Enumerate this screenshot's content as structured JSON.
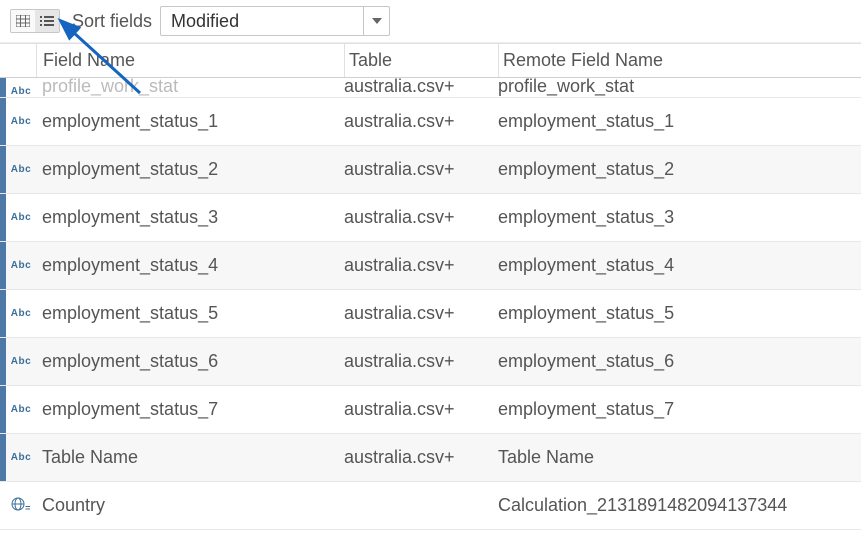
{
  "toolbar": {
    "sort_label": "Sort fields",
    "dropdown_value": "Modified"
  },
  "columns": {
    "field": "Field Name",
    "table": "Table",
    "remote": "Remote Field Name"
  },
  "type_labels": {
    "abc": "Abc"
  },
  "rows": [
    {
      "cutoff": true,
      "blue": true,
      "type": "abc",
      "field": "profile_work_stat",
      "table": "australia.csv+",
      "remote": "profile_work_stat",
      "alt": false
    },
    {
      "blue": true,
      "type": "abc",
      "field": "employment_status_1",
      "table": "australia.csv+",
      "remote": "employment_status_1",
      "alt": false
    },
    {
      "blue": true,
      "type": "abc",
      "field": "employment_status_2",
      "table": "australia.csv+",
      "remote": "employment_status_2",
      "alt": true
    },
    {
      "blue": true,
      "type": "abc",
      "field": "employment_status_3",
      "table": "australia.csv+",
      "remote": "employment_status_3",
      "alt": false
    },
    {
      "blue": true,
      "type": "abc",
      "field": "employment_status_4",
      "table": "australia.csv+",
      "remote": "employment_status_4",
      "alt": true
    },
    {
      "blue": true,
      "type": "abc",
      "field": "employment_status_5",
      "table": "australia.csv+",
      "remote": "employment_status_5",
      "alt": false
    },
    {
      "blue": true,
      "type": "abc",
      "field": "employment_status_6",
      "table": "australia.csv+",
      "remote": "employment_status_6",
      "alt": true
    },
    {
      "blue": true,
      "type": "abc",
      "field": "employment_status_7",
      "table": "australia.csv+",
      "remote": "employment_status_7",
      "alt": false
    },
    {
      "blue": true,
      "type": "abc",
      "field": "Table Name",
      "table": "australia.csv+",
      "remote": "Table Name",
      "alt": true
    },
    {
      "blue": false,
      "type": "globe",
      "field": "Country",
      "table": "",
      "remote": "Calculation_2131891482094137344",
      "alt": false
    }
  ]
}
